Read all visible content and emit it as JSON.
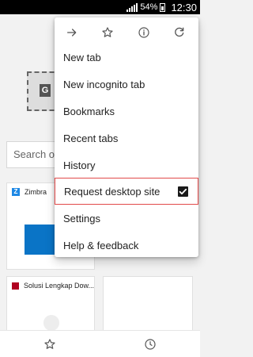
{
  "status_bar": {
    "battery": "54%",
    "time": "12:30"
  },
  "search": {
    "placeholder": "Search or"
  },
  "tiles": [
    {
      "title": "Zimbra",
      "favicon_letter": "Z"
    },
    {
      "title": "Solusi Lengkap Dow..."
    },
    {
      "title": ""
    }
  ],
  "menu": {
    "toolbar_icons": [
      "forward-icon",
      "bookmark-star-icon",
      "info-icon",
      "refresh-icon"
    ],
    "items": [
      {
        "label": "New tab"
      },
      {
        "label": "New incognito tab"
      },
      {
        "label": "Bookmarks"
      },
      {
        "label": "Recent tabs"
      },
      {
        "label": "History"
      },
      {
        "label": "Request desktop site",
        "checked": true
      },
      {
        "label": "Settings"
      },
      {
        "label": "Help & feedback"
      }
    ]
  },
  "bottom_bar": {
    "icons": [
      "star-icon",
      "history-clock-icon"
    ]
  },
  "colors": {
    "highlight_border": "#e24a4a",
    "zimbra_blue": "#0a74c6"
  }
}
